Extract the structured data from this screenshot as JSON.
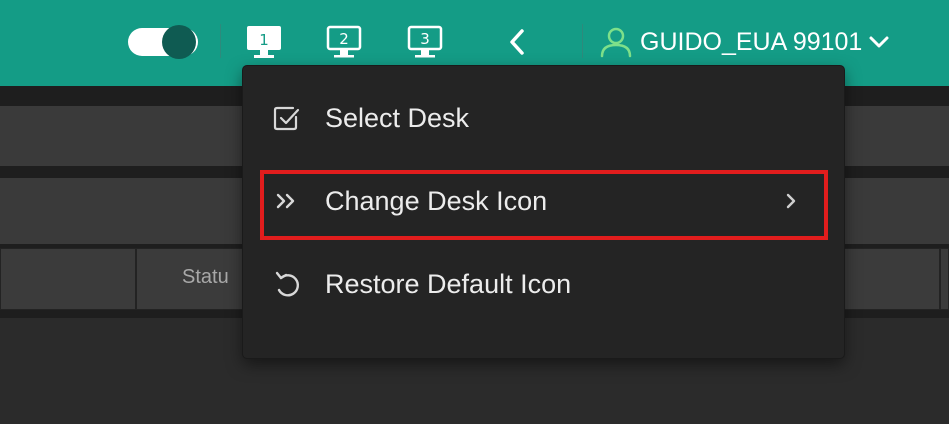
{
  "topbar": {
    "accent_color": "#149c86",
    "toggle": {
      "state": "on"
    },
    "desks": [
      {
        "label": "1",
        "active": true
      },
      {
        "label": "2",
        "active": false
      },
      {
        "label": "3",
        "active": false
      }
    ],
    "back_icon": "chevron-left-icon",
    "user": {
      "name": "GUIDO_EUA 99101",
      "icon": "user-icon",
      "caret": "chevron-down-icon"
    }
  },
  "background": {
    "column_label": "Statu"
  },
  "context_menu": {
    "items": [
      {
        "label": "Select Desk",
        "icon": "checkbox-icon"
      },
      {
        "label": "Change Desk Icon",
        "icon": "double-chevron-right-icon",
        "has_submenu": true
      },
      {
        "label": "Restore Default Icon",
        "icon": "restore-icon"
      }
    ],
    "highlight_color": "#e11d1d"
  }
}
